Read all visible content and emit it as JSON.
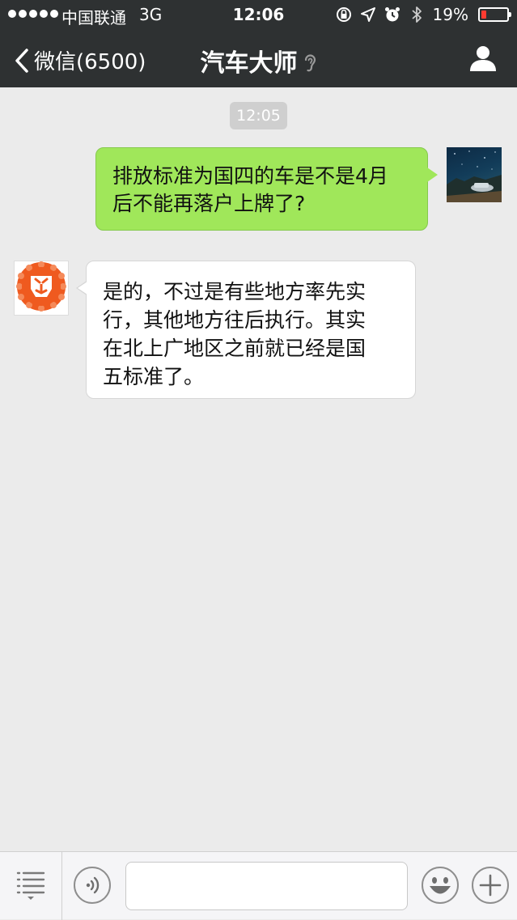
{
  "status_bar": {
    "carrier": "中国联通",
    "network": "3G",
    "time": "12:06",
    "battery_percent": "19%",
    "battery_level": 0.19,
    "icons": [
      "orientation-lock-icon",
      "location-arrow-icon",
      "alarm-icon",
      "bluetooth-icon"
    ]
  },
  "nav": {
    "back_label": "微信(6500)",
    "title": "汽车大师",
    "title_icon": "ear-icon",
    "right_icon": "person-icon"
  },
  "chat": {
    "timestamp": "12:05",
    "messages": [
      {
        "side": "out",
        "lines": [
          "排放标准为国四的车是不是4月",
          "后不能再落户上牌了?"
        ]
      },
      {
        "side": "in",
        "lines": [
          "是的，不过是有些地方率先实",
          "行，其他地方往后执行。其实",
          "在北上广地区之前就已经是国",
          "五标准了。"
        ]
      }
    ]
  },
  "input_bar": {
    "input_value": "",
    "icons": [
      "menu-list-icon",
      "voice-icon",
      "emoji-icon",
      "plus-icon"
    ]
  },
  "colors": {
    "nav_background": "#2e3132",
    "chat_background": "#ebebeb",
    "outgoing_bubble": "#a0e75a",
    "incoming_bubble": "#ffffff",
    "battery_low": "#ff3b30",
    "bot_avatar_orange": "#ef5a1f"
  }
}
